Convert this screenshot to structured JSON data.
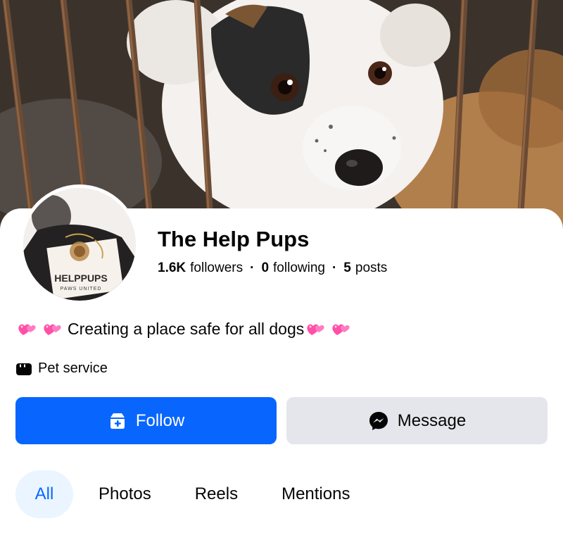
{
  "profile": {
    "name": "The Help Pups",
    "followers_count": "1.6K",
    "followers_label": "followers",
    "following_count": "0",
    "following_label": "following",
    "posts_count": "5",
    "posts_label": "posts",
    "separator": "·",
    "bio_text": "Creating a place safe for all dogs",
    "category": "Pet service"
  },
  "avatar": {
    "logo_main": "HELPPUPS",
    "logo_sub": "PAWS UNITED"
  },
  "actions": {
    "follow_label": "Follow",
    "message_label": "Message"
  },
  "tabs": [
    {
      "label": "All"
    },
    {
      "label": "Photos"
    },
    {
      "label": "Reels"
    },
    {
      "label": "Mentions"
    }
  ],
  "colors": {
    "primary": "#0866ff",
    "secondary_bg": "#e4e6eb",
    "active_tab_bg": "#ebf5ff",
    "heart": "#ff4fa8"
  }
}
